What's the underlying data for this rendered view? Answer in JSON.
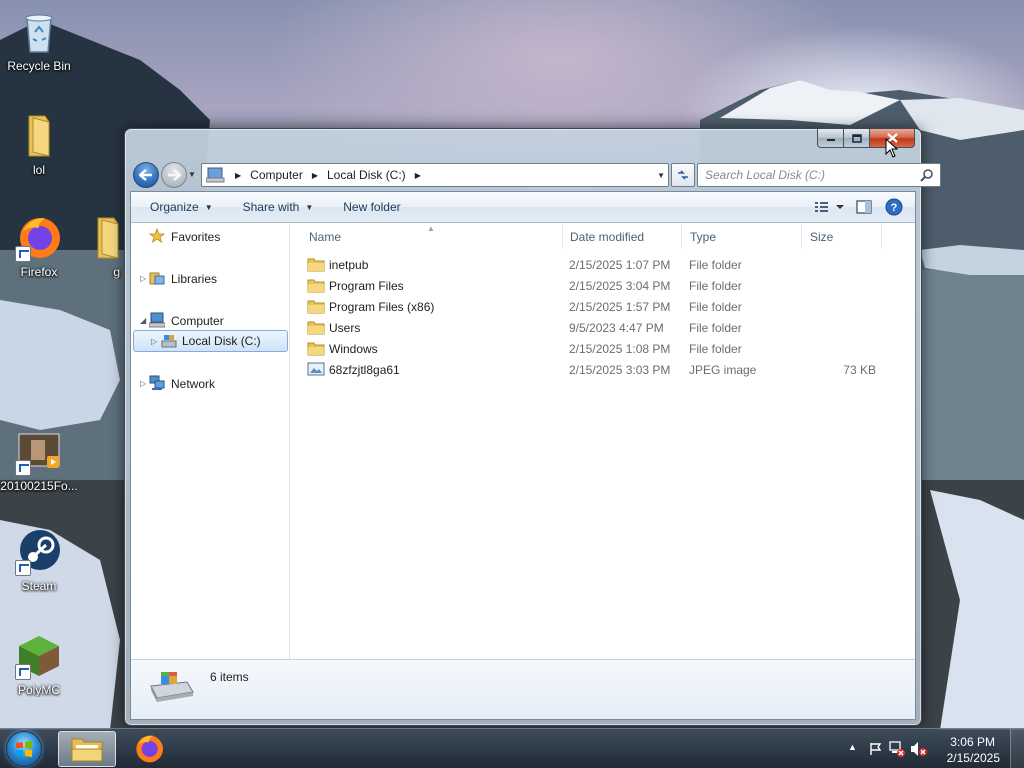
{
  "desktop": {
    "icons": [
      {
        "label": "Recycle Bin",
        "icon": "recycle-bin-icon"
      },
      {
        "label": "lol",
        "icon": "folder-icon"
      },
      {
        "label": "Firefox",
        "icon": "firefox-icon"
      },
      {
        "label": "g",
        "icon": "folder-icon"
      },
      {
        "label": "20100215Fo...",
        "icon": "video-file-icon"
      },
      {
        "label": "Steam",
        "icon": "steam-icon"
      },
      {
        "label": "PolyMC",
        "icon": "polymc-icon"
      }
    ]
  },
  "window": {
    "address": {
      "crumbs": [
        "Computer",
        "Local Disk (C:)"
      ]
    },
    "search": {
      "placeholder": "Search Local Disk (C:)"
    },
    "toolbar": {
      "organize": "Organize",
      "share_with": "Share with",
      "new_folder": "New folder"
    },
    "nav_pane": {
      "favorites": "Favorites",
      "libraries": "Libraries",
      "computer": "Computer",
      "local_disk": "Local Disk (C:)",
      "network": "Network"
    },
    "columns": {
      "name": "Name",
      "date_modified": "Date modified",
      "type": "Type",
      "size": "Size"
    },
    "files": [
      {
        "name": "inetpub",
        "date": "2/15/2025 1:07 PM",
        "type": "File folder",
        "size": "",
        "icon": "folder-icon"
      },
      {
        "name": "Program Files",
        "date": "2/15/2025 3:04 PM",
        "type": "File folder",
        "size": "",
        "icon": "folder-icon"
      },
      {
        "name": "Program Files (x86)",
        "date": "2/15/2025 1:57 PM",
        "type": "File folder",
        "size": "",
        "icon": "folder-icon"
      },
      {
        "name": "Users",
        "date": "9/5/2023 4:47 PM",
        "type": "File folder",
        "size": "",
        "icon": "folder-icon"
      },
      {
        "name": "Windows",
        "date": "2/15/2025 1:08 PM",
        "type": "File folder",
        "size": "",
        "icon": "folder-icon"
      },
      {
        "name": "68zfzjtl8ga61",
        "date": "2/15/2025 3:03 PM",
        "type": "JPEG image",
        "size": "73 KB",
        "icon": "image-file-icon"
      }
    ],
    "status": {
      "item_count": "6 items"
    }
  },
  "taskbar": {
    "clock_time": "3:06 PM",
    "clock_date": "2/15/2025"
  },
  "colors": {
    "selection_bg": "#cfe3f9",
    "selection_border": "#84acdd",
    "close_button": "#c8452a",
    "header_text": "#4c607a"
  }
}
